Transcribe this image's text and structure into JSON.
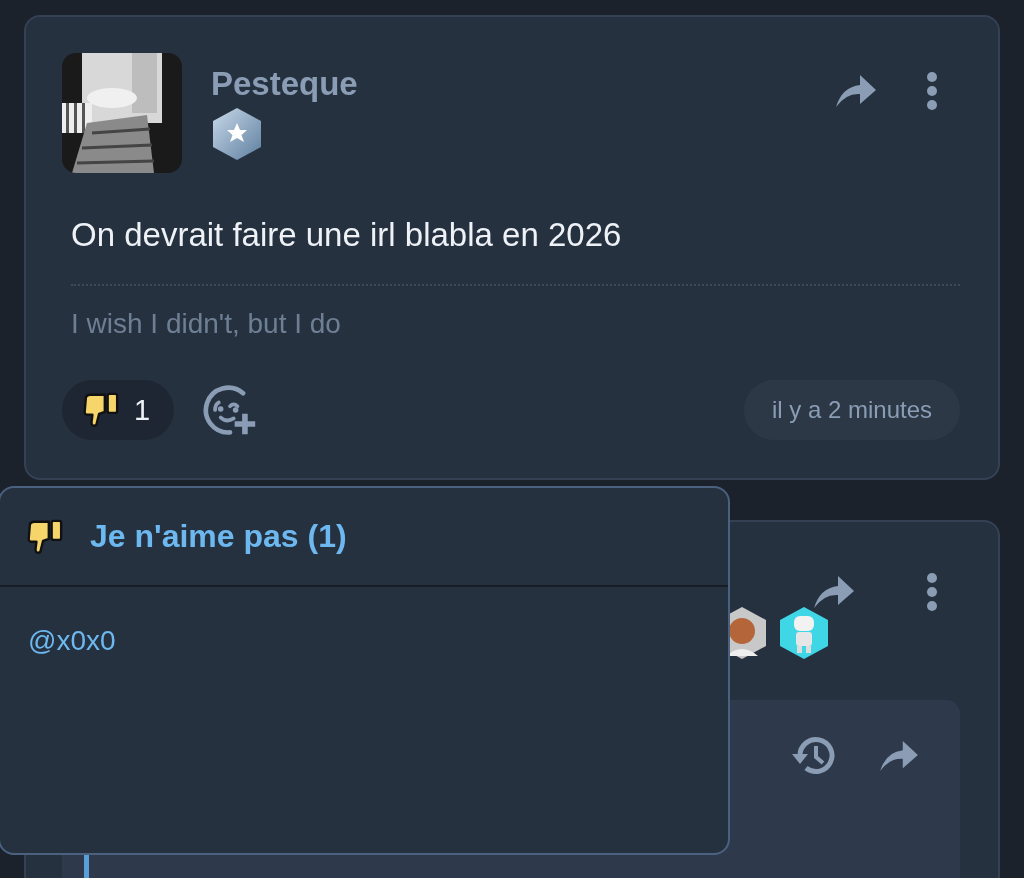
{
  "post": {
    "author": "Pesteque",
    "text": "On devrait faire une irl blabla en 2026",
    "subtitle": "I wish I didn't, but I do",
    "reactions": [
      {
        "kind": "dislike",
        "count": "1"
      }
    ],
    "time": "il y a 2 minutes"
  },
  "reaction_popup": {
    "kind": "dislike",
    "title": "Je n'aime pas (1)",
    "users": [
      "@x0x0"
    ]
  }
}
